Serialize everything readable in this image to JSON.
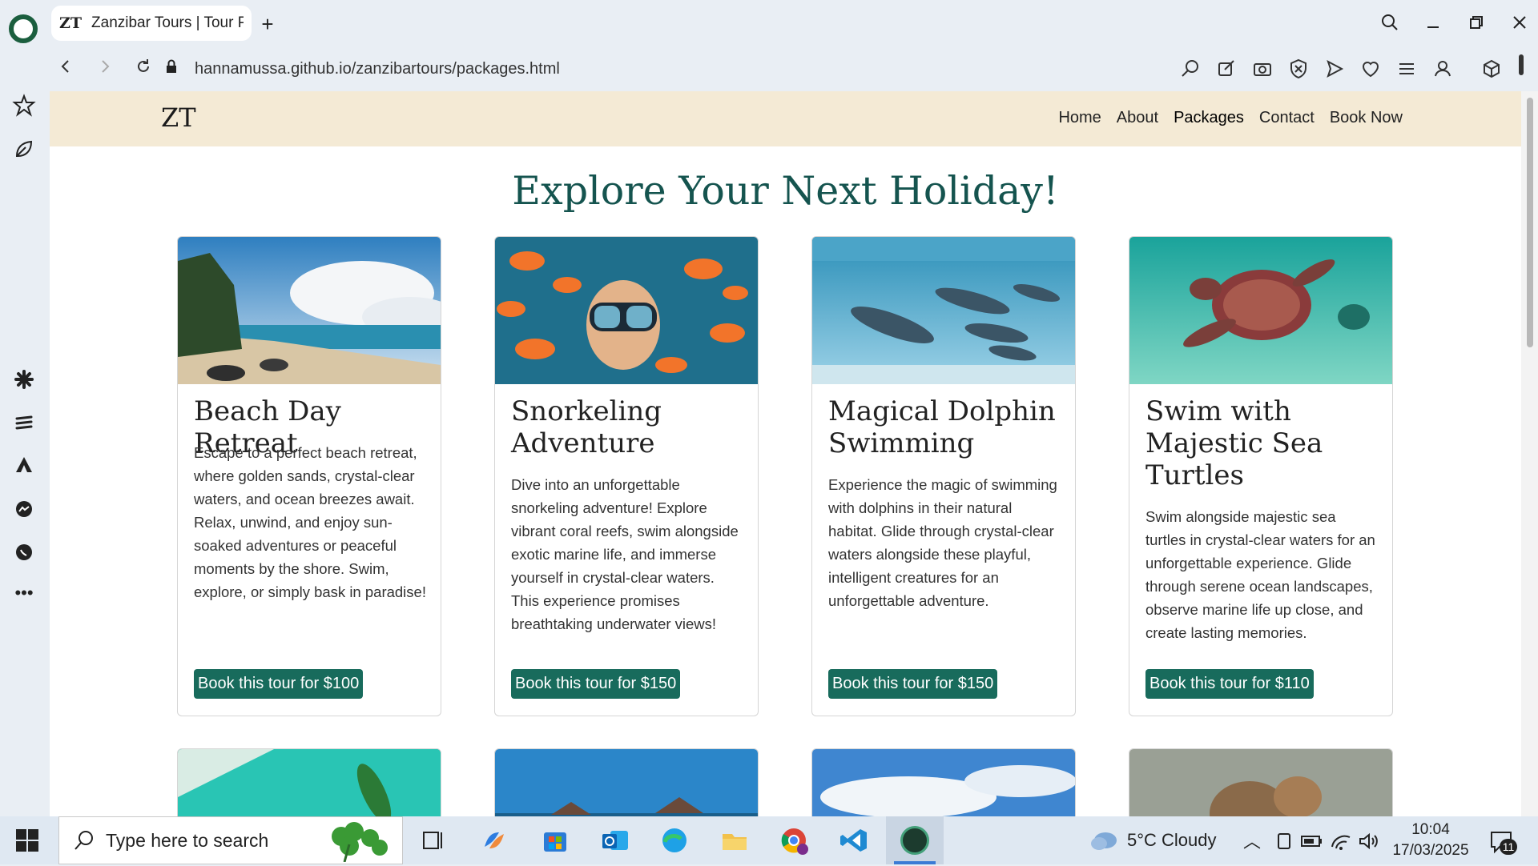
{
  "browser": {
    "tab_title": "Zanzibar Tours | Tour Pac",
    "tab_favicon": "ZT",
    "url": "hannamussa.github.io/zanzibartours/packages.html"
  },
  "site": {
    "logo": "ZT",
    "nav": [
      "Home",
      "About",
      "Packages",
      "Contact",
      "Book Now"
    ],
    "heading": "Explore Your Next Holiday!",
    "colors": {
      "accent": "#186b5c",
      "heading": "#15544f",
      "nav_bg": "#f4ead5"
    },
    "packages": [
      {
        "title": "Beach Day Retreat",
        "description": "Escape to a perfect beach retreat, where golden sands, crystal-clear waters, and ocean breezes await. Relax, unwind, and enjoy sun-soaked adventures or peaceful moments by the shore. Swim, explore, or simply bask in paradise!",
        "button": "Book this tour for $100",
        "image": "beach-photo"
      },
      {
        "title": "Snorkeling Adventure",
        "description": "Dive into an unforgettable snorkeling adventure! Explore vibrant coral reefs, swim alongside exotic marine life, and immerse yourself in crystal-clear waters. This experience promises breathtaking underwater views!",
        "button": "Book this tour for $150",
        "image": "snorkeler-photo"
      },
      {
        "title": "Magical Dolphin Swimming",
        "description": "Experience the magic of swimming with dolphins in their natural habitat. Glide through crystal-clear waters alongside these playful, intelligent creatures for an unforgettable adventure.",
        "button": "Book this tour for $150",
        "image": "dolphins-photo"
      },
      {
        "title": "Swim with Majestic Sea Turtles",
        "description": "Swim alongside majestic sea turtles in crystal-clear waters for an unforgettable experience. Glide through serene ocean landscapes, observe marine life up close, and create lasting memories.",
        "button": "Book this tour for $110",
        "image": "turtle-photo"
      }
    ]
  },
  "taskbar": {
    "search_placeholder": "Type here to search",
    "weather": "5°C  Cloudy",
    "time": "10:04",
    "date": "17/03/2025",
    "notifications": "11"
  }
}
